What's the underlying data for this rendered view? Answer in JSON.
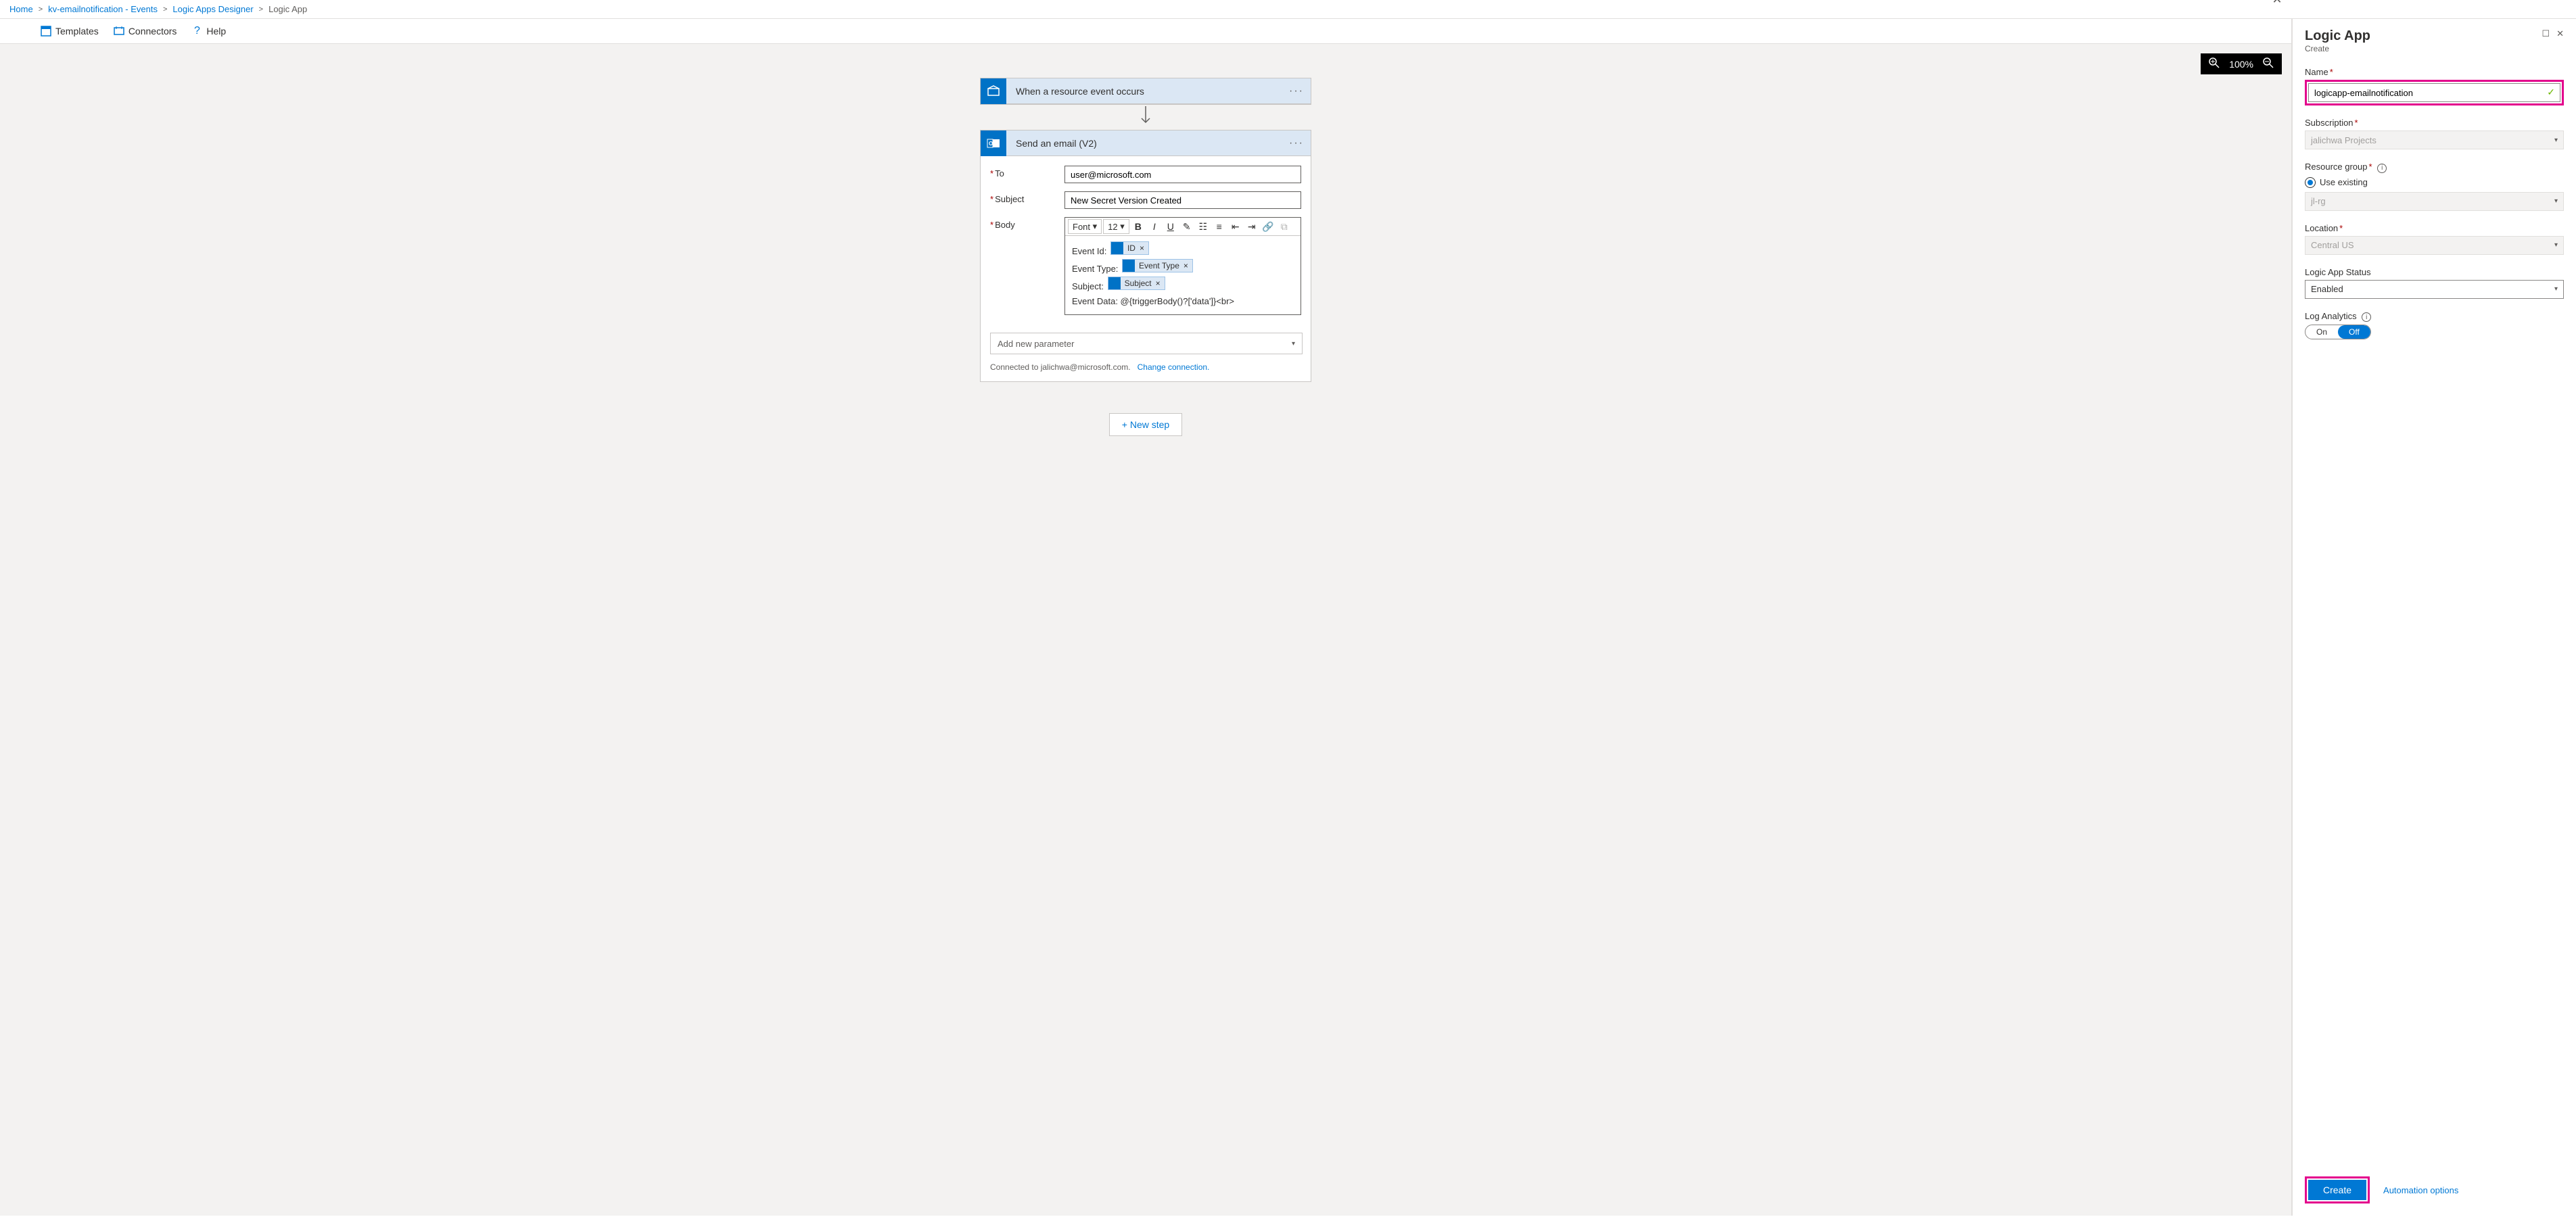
{
  "breadcrumb": {
    "home": "Home",
    "kv": "kv-emailnotification - Events",
    "designer": "Logic Apps Designer",
    "current": "Logic App"
  },
  "cmdbar": {
    "templates": "Templates",
    "connectors": "Connectors",
    "help": "Help"
  },
  "zoom": {
    "value": "100%"
  },
  "trigger_card": {
    "title": "When a resource event occurs"
  },
  "email_card": {
    "title": "Send an email (V2)",
    "to_label": "To",
    "to_value": "user@microsoft.com",
    "subject_label": "Subject",
    "subject_value": "New Secret Version Created",
    "body_label": "Body",
    "font_label": "Font",
    "size_label": "12",
    "body": {
      "l1": "Event Id:",
      "chip1": "ID",
      "l2": "Event Type:",
      "chip2": "Event Type",
      "l3": "Subject:",
      "chip3": "Subject",
      "l4": "Event Data: @{triggerBody()?['data']}<br>"
    },
    "add_param": "Add new parameter",
    "connected_pre": "Connected to jalichwa@microsoft.com.",
    "change_conn": "Change connection."
  },
  "newstep": "+ New step",
  "side": {
    "title": "Logic App",
    "subtitle": "Create",
    "name_label": "Name",
    "name_value": "logicapp-emailnotification",
    "sub_label": "Subscription",
    "sub_value": "jalichwa Projects",
    "rg_label": "Resource group",
    "rg_use_existing": "Use existing",
    "rg_value": "jl-rg",
    "loc_label": "Location",
    "loc_value": "Central US",
    "status_label": "Logic App Status",
    "status_value": "Enabled",
    "la_label": "Log Analytics",
    "la_on": "On",
    "la_off": "Off",
    "create": "Create",
    "auto": "Automation options"
  }
}
